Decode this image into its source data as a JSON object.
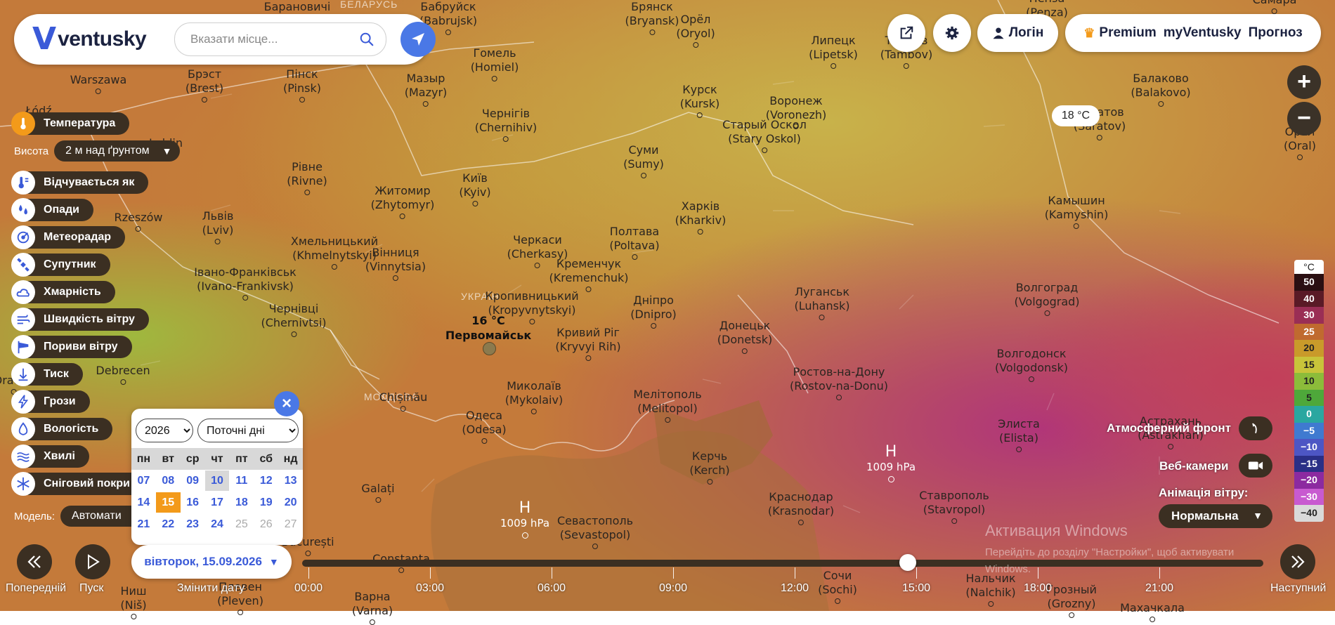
{
  "app": {
    "logo_text": "ventusky",
    "logo_mark": "V"
  },
  "search": {
    "placeholder": "Вказати місце..."
  },
  "header": {
    "login_label": "Логін",
    "premium_label": "Premium",
    "myventusky_label": "myVentusky",
    "forecast_label": "Прогноз"
  },
  "map_chip": {
    "temp": "18 °C"
  },
  "selected_point": {
    "temp": "16 °C",
    "name": "Первомайськ"
  },
  "layers": {
    "temperature": "Температура",
    "height_label": "Висота",
    "height_value": "2 м над ґрунтом",
    "feels_like": "Відчувається як",
    "precipitation": "Опади",
    "radar": "Метеорадар",
    "satellite": "Супутник",
    "clouds": "Хмарність",
    "wind_speed": "Швидкість вітру",
    "wind_gusts": "Пориви вітру",
    "pressure": "Тиск",
    "storms": "Грози",
    "humidity": "Вологість",
    "waves": "Хвилі",
    "snow": "Сніговий покри",
    "model_label": "Модель:",
    "model_value": "Автомати"
  },
  "calendar": {
    "year": "2026",
    "mode": "Поточні дні",
    "weekdays": [
      "пн",
      "вт",
      "ср",
      "чт",
      "пт",
      "сб",
      "нд"
    ],
    "week1": [
      "07",
      "08",
      "09",
      "10",
      "11",
      "12",
      "13"
    ],
    "week2": [
      "14",
      "15",
      "16",
      "17",
      "18",
      "19",
      "20"
    ],
    "week3": [
      "21",
      "22",
      "23",
      "24",
      "25",
      "26",
      "27"
    ],
    "selected_day": "15",
    "today_day": "10",
    "disabled_days": [
      "25",
      "26",
      "27"
    ]
  },
  "date_pill": {
    "label": "вівторок, 15.09.2026"
  },
  "timeline": {
    "prev_label": "Попередній",
    "play_label": "Пуск",
    "change_date_label": "Змінити дату",
    "next_label": "Наступний",
    "hours": [
      "00:00",
      "03:00",
      "06:00",
      "09:00",
      "12:00",
      "15:00",
      "18:00",
      "21:00"
    ],
    "position_fraction": 0.63
  },
  "right_panel": {
    "fronts_label": "Атмосферний фронт",
    "webcams_label": "Веб-камери",
    "wind_anim_label": "Анімація вітру:",
    "wind_anim_value": "Нормальна"
  },
  "legend": {
    "unit": "°C",
    "values": [
      "50",
      "40",
      "30",
      "25",
      "20",
      "15",
      "10",
      "5",
      "0",
      "−5",
      "−10",
      "−15",
      "−20",
      "−30",
      "−40"
    ],
    "colors": [
      "#2a0f12",
      "#5a1a26",
      "#9a2e55",
      "#c06a2f",
      "#c99a2a",
      "#c8c43a",
      "#8cbc3a",
      "#4ea83a",
      "#2aa7a0",
      "#3f7ad0",
      "#4d56c4",
      "#2a2f86",
      "#8c2aa0",
      "#c85ad0",
      "#d9d9d9"
    ]
  },
  "pressure_centers": [
    {
      "h": "H",
      "hpa": "1009 hPa"
    },
    {
      "h": "H",
      "hpa": "1009 hPa"
    }
  ],
  "watermark": {
    "title": "Активация Windows",
    "text": "Перейдіть до розділу \"Настройки\", щоб активувати Windows."
  },
  "countries": {
    "belarus": "БЕЛАРУСЬ",
    "ukraine": "УКРАЇН",
    "moldova": "МОЛДОВА"
  },
  "cities": [
    {
      "n": "Warszawa",
      "l": ""
    },
    {
      "n": "Барановичі",
      "l": ""
    },
    {
      "n": "Бабруйск",
      "l": "(Babrujsk)"
    },
    {
      "n": "Брянск",
      "l": "(Bryansk)"
    },
    {
      "n": "Орёл",
      "l": "(Oryol)"
    },
    {
      "n": "Пенза",
      "l": "(Penza)"
    },
    {
      "n": "Самара",
      "l": ""
    },
    {
      "n": "Брэст",
      "l": "(Brest)"
    },
    {
      "n": "Пінск",
      "l": "(Pinsk)"
    },
    {
      "n": "Мазыр",
      "l": "(Mazyr)"
    },
    {
      "n": "Гомель",
      "l": "(Homiel)"
    },
    {
      "n": "Липецк",
      "l": "(Lipetsk)"
    },
    {
      "n": "Балаково",
      "l": "(Balakovo)"
    },
    {
      "n": "Чернігів",
      "l": "(Chernihiv)"
    },
    {
      "n": "Курск",
      "l": "(Kursk)"
    },
    {
      "n": "Воронеж",
      "l": "(Voronezh)"
    },
    {
      "n": "Саратов",
      "l": "(Saratov)"
    },
    {
      "n": "Старый Оскол",
      "l": "(Stary Oskol)"
    },
    {
      "n": "Орал",
      "l": "(Oral)"
    },
    {
      "n": "Суми",
      "l": "(Sumy)"
    },
    {
      "n": "Рівне",
      "l": "(Rivne)"
    },
    {
      "n": "Київ",
      "l": "(Kyiv)"
    },
    {
      "n": "Житомир",
      "l": "(Zhytomyr)"
    },
    {
      "n": "Харків",
      "l": "(Kharkiv)"
    },
    {
      "n": "Камышин",
      "l": "(Kamyshin)"
    },
    {
      "n": "Rzeszów",
      "l": ""
    },
    {
      "n": "Львів",
      "l": "(Lviv)"
    },
    {
      "n": "Хмельницький",
      "l": "(Khmelnytskyi)"
    },
    {
      "n": "Черкаси",
      "l": "(Cherkasy)"
    },
    {
      "n": "Полтава",
      "l": "(Poltava)"
    },
    {
      "n": "Вінниця",
      "l": "(Vinnytsia)"
    },
    {
      "n": "Кременчук",
      "l": "(Kremenchuk)"
    },
    {
      "n": "Івано-Франківськ",
      "l": "(Ivano-Frankivsk)"
    },
    {
      "n": "Луганськ",
      "l": "(Luhansk)"
    },
    {
      "n": "Волгоград",
      "l": "(Volgograd)"
    },
    {
      "n": "Кропивницький",
      "l": "(Kropyvnytskyi)"
    },
    {
      "n": "Дніпро",
      "l": "(Dnipro)"
    },
    {
      "n": "Чернівці",
      "l": "(Chernivtsi)"
    },
    {
      "n": "Донецьк",
      "l": "(Donetsk)"
    },
    {
      "n": "Кривий Ріг",
      "l": "(Kryvyi Rih)"
    },
    {
      "n": "Волгодонск",
      "l": "(Volgodonsk)"
    },
    {
      "n": "Debrecen",
      "l": ""
    },
    {
      "n": "Ростов-на-Дону",
      "l": "(Rostov-na-Donu)"
    },
    {
      "n": "Миколаїв",
      "l": "(Mykolaiv)"
    },
    {
      "n": "Chișinău",
      "l": ""
    },
    {
      "n": "Мелітополь",
      "l": "(Melitopol)"
    },
    {
      "n": "Одеса",
      "l": "(Odesa)"
    },
    {
      "n": "Элиста",
      "l": "(Elista)"
    },
    {
      "n": "Астрахань",
      "l": "(Astrakhan)"
    },
    {
      "n": "Керчь",
      "l": "(Kerch)"
    },
    {
      "n": "Galați",
      "l": ""
    },
    {
      "n": "Краснодар",
      "l": "(Krasnodar)"
    },
    {
      "n": "Ставрополь",
      "l": "(Stavropol)"
    },
    {
      "n": "Севастополь",
      "l": "(Sevastopol)"
    },
    {
      "n": "București",
      "l": ""
    },
    {
      "n": "Constanța",
      "l": ""
    },
    {
      "n": "Сочи",
      "l": "(Sochi)"
    },
    {
      "n": "Нальчик",
      "l": "(Nalchik)"
    },
    {
      "n": "Грозный",
      "l": "(Grozny)"
    },
    {
      "n": "Ниш",
      "l": "(Niš)"
    },
    {
      "n": "Плевен",
      "l": "(Pleven)"
    },
    {
      "n": "Варна",
      "l": "(Varna)"
    },
    {
      "n": "Махачкала",
      "l": ""
    },
    {
      "n": "Łódź",
      "l": ""
    },
    {
      "n": "Lublin",
      "l": ""
    },
    {
      "n": "Тамбов",
      "l": "(Tambov)"
    },
    {
      "n": "Oradea",
      "l": ""
    }
  ]
}
